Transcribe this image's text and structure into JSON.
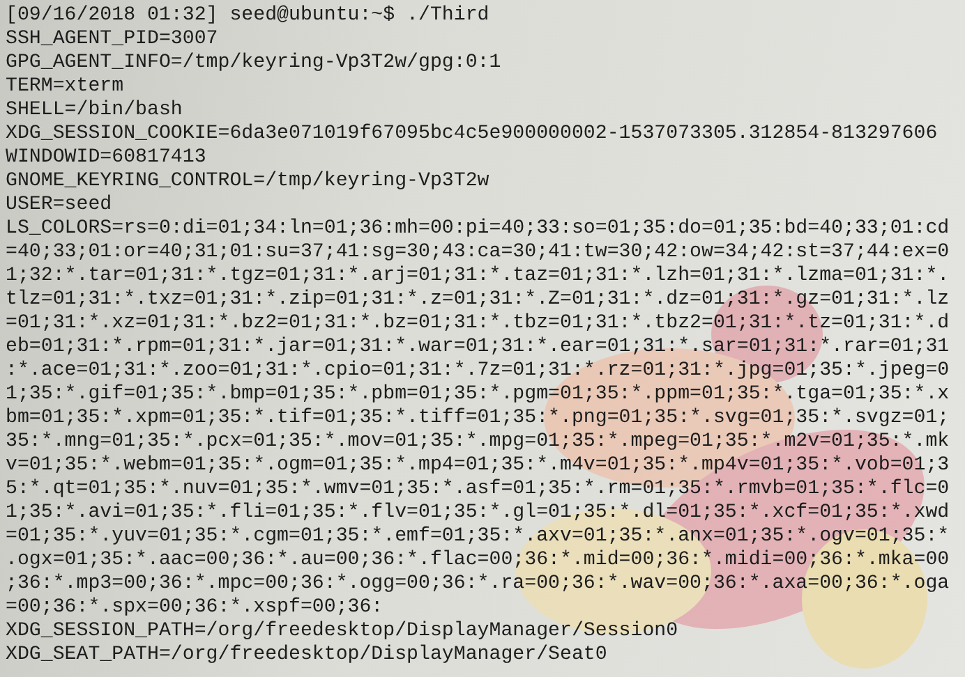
{
  "terminal": {
    "lines": [
      "[09/16/2018 01:32] seed@ubuntu:~$ ./Third",
      "SSH_AGENT_PID=3007",
      "GPG_AGENT_INFO=/tmp/keyring-Vp3T2w/gpg:0:1",
      "TERM=xterm",
      "SHELL=/bin/bash",
      "XDG_SESSION_COOKIE=6da3e071019f67095bc4c5e900000002-1537073305.312854-813297606",
      "WINDOWID=60817413",
      "GNOME_KEYRING_CONTROL=/tmp/keyring-Vp3T2w",
      "USER=seed",
      "LS_COLORS=rs=0:di=01;34:ln=01;36:mh=00:pi=40;33:so=01;35:do=01;35:bd=40;33;01:cd",
      "=40;33;01:or=40;31;01:su=37;41:sg=30;43:ca=30;41:tw=30;42:ow=34;42:st=37;44:ex=0",
      "1;32:*.tar=01;31:*.tgz=01;31:*.arj=01;31:*.taz=01;31:*.lzh=01;31:*.lzma=01;31:*.",
      "tlz=01;31:*.txz=01;31:*.zip=01;31:*.z=01;31:*.Z=01;31:*.dz=01;31:*.gz=01;31:*.lz",
      "=01;31:*.xz=01;31:*.bz2=01;31:*.bz=01;31:*.tbz=01;31:*.tbz2=01;31:*.tz=01;31:*.d",
      "eb=01;31:*.rpm=01;31:*.jar=01;31:*.war=01;31:*.ear=01;31:*.sar=01;31:*.rar=01;31",
      ":*.ace=01;31:*.zoo=01;31:*.cpio=01;31:*.7z=01;31:*.rz=01;31:*.jpg=01;35:*.jpeg=0",
      "1;35:*.gif=01;35:*.bmp=01;35:*.pbm=01;35:*.pgm=01;35:*.ppm=01;35:*.tga=01;35:*.x",
      "bm=01;35:*.xpm=01;35:*.tif=01;35:*.tiff=01;35:*.png=01;35:*.svg=01;35:*.svgz=01;",
      "35:*.mng=01;35:*.pcx=01;35:*.mov=01;35:*.mpg=01;35:*.mpeg=01;35:*.m2v=01;35:*.mk",
      "v=01;35:*.webm=01;35:*.ogm=01;35:*.mp4=01;35:*.m4v=01;35:*.mp4v=01;35:*.vob=01;3",
      "5:*.qt=01;35:*.nuv=01;35:*.wmv=01;35:*.asf=01;35:*.rm=01;35:*.rmvb=01;35:*.flc=0",
      "1;35:*.avi=01;35:*.fli=01;35:*.flv=01;35:*.gl=01;35:*.dl=01;35:*.xcf=01;35:*.xwd",
      "=01;35:*.yuv=01;35:*.cgm=01;35:*.emf=01;35:*.axv=01;35:*.anx=01;35:*.ogv=01;35:*",
      ".ogx=01;35:*.aac=00;36:*.au=00;36:*.flac=00;36:*.mid=00;36:*.midi=00;36:*.mka=00",
      ";36:*.mp3=00;36:*.mpc=00;36:*.ogg=00;36:*.ra=00;36:*.wav=00;36:*.axa=00;36:*.oga",
      "=00;36:*.spx=00;36:*.xspf=00;36:",
      "XDG_SESSION_PATH=/org/freedesktop/DisplayManager/Session0",
      "XDG_SEAT_PATH=/org/freedesktop/DisplayManager/Seat0"
    ]
  }
}
